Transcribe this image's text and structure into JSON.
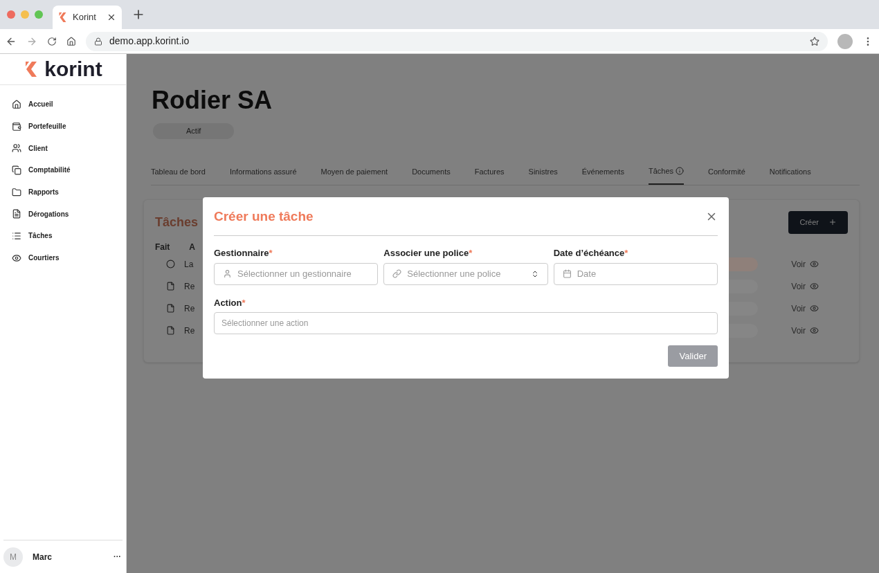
{
  "browser": {
    "tab_title": "Korint",
    "url": "demo.app.korint.io"
  },
  "sidebar": {
    "logo": "korint",
    "items": [
      {
        "label": "Accueil"
      },
      {
        "label": "Portefeuille"
      },
      {
        "label": "Client"
      },
      {
        "label": "Comptabilité"
      },
      {
        "label": "Rapports"
      },
      {
        "label": "Dérogations"
      },
      {
        "label": "Tâches"
      },
      {
        "label": "Courtiers"
      }
    ],
    "user": {
      "initial": "M",
      "name": "Marc",
      "menu": "···"
    }
  },
  "page": {
    "title": "Rodier SA",
    "status": "Actif",
    "tabs": [
      {
        "label": "Tableau de bord",
        "selected": false
      },
      {
        "label": "Informations assuré",
        "selected": false
      },
      {
        "label": "Moyen de paiement",
        "selected": false
      },
      {
        "label": "Documents",
        "selected": false
      },
      {
        "label": "Factures",
        "selected": false
      },
      {
        "label": "Sinistres",
        "selected": false
      },
      {
        "label": "Événements",
        "selected": false
      },
      {
        "label": "Tâches",
        "selected": true
      },
      {
        "label": "Conformité",
        "selected": false
      },
      {
        "label": "Notifications",
        "selected": false
      }
    ],
    "card": {
      "title": "Tâches",
      "create_button": "Créer",
      "columns": [
        "Fait",
        "A"
      ],
      "rows": [
        {
          "kind": "circle",
          "text": "La",
          "color": "#8f807a",
          "link": "Voir"
        },
        {
          "kind": "doc",
          "text": "Re",
          "color": "#868686",
          "link": "Voir"
        },
        {
          "kind": "doc",
          "text": "Re",
          "color": "#868686",
          "link": "Voir"
        },
        {
          "kind": "doc",
          "text": "Re",
          "color": "#868686",
          "link": "Voir"
        }
      ]
    }
  },
  "modal": {
    "title": "Créer une tâche",
    "fields": [
      {
        "kind": "user",
        "label": "Gestionnaire",
        "required_mark": "*",
        "placeholder": "Sélectionner un gestionnaire"
      },
      {
        "kind": "select",
        "label": "Associer une police",
        "required_mark": "*",
        "placeholder": "Sélectionner une police"
      },
      {
        "kind": "date",
        "label": "Date d’échéance",
        "required_mark": "*",
        "placeholder": "Date"
      }
    ],
    "action": {
      "label": "Action",
      "required_mark": "*",
      "placeholder": "Sélectionner une action"
    },
    "submit": {
      "label": "Valider",
      "disabled": true
    }
  }
}
